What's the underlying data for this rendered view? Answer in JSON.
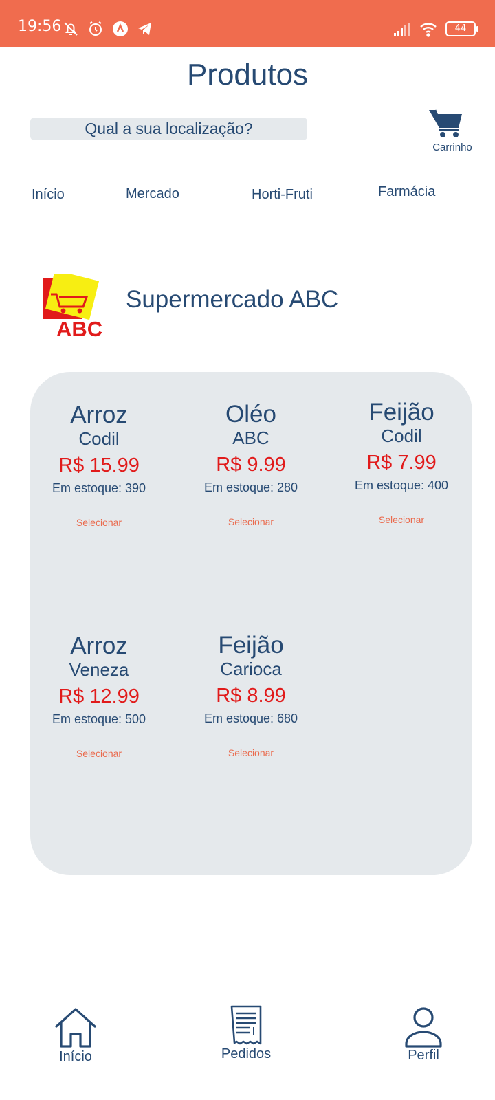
{
  "status_bar": {
    "time": "19:56",
    "battery": "44",
    "background_color": "#f06c4e",
    "left_icons": [
      "bell-off-icon",
      "alarm-icon",
      "app-a-icon",
      "telegram-icon"
    ],
    "right_icons": [
      "signal-icon",
      "wifi-icon",
      "battery-icon"
    ]
  },
  "header": {
    "title": "Produtos"
  },
  "location": {
    "label": "Qual a sua localização?"
  },
  "cart": {
    "label": "Carrinho",
    "icon": "cart-icon"
  },
  "categories": [
    {
      "label": "Início"
    },
    {
      "label": "Mercado"
    },
    {
      "label": "Horti-Fruti"
    },
    {
      "label": "Farmácia"
    }
  ],
  "store": {
    "name": "Supermercado ABC",
    "logo_text": "ABC"
  },
  "products": [
    {
      "name": "Arroz",
      "brand": "Codil",
      "price": "R$ 15.99",
      "stock": "Em estoque: 390",
      "action": "Selecionar"
    },
    {
      "name": "Oléo",
      "brand": "ABC",
      "price": "R$ 9.99",
      "stock": "Em estoque: 280",
      "action": "Selecionar"
    },
    {
      "name": "Feijão",
      "brand": "Codil",
      "price": "R$ 7.99",
      "stock": "Em estoque: 400",
      "action": "Selecionar"
    },
    {
      "name": "Arroz",
      "brand": "Veneza",
      "price": "R$ 12.99",
      "stock": "Em estoque: 500",
      "action": "Selecionar"
    },
    {
      "name": "Feijão",
      "brand": "Carioca",
      "price": "R$ 8.99",
      "stock": "Em estoque: 680",
      "action": "Selecionar"
    }
  ],
  "nav": [
    {
      "label": "Início",
      "icon": "home-icon"
    },
    {
      "label": "Pedidos",
      "icon": "receipt-icon"
    },
    {
      "label": "Perfil",
      "icon": "user-icon"
    }
  ],
  "colors": {
    "primary_text": "#274a73",
    "price": "#e11b1b",
    "action": "#ea6b4e",
    "panel_bg": "#e5e9ec"
  }
}
